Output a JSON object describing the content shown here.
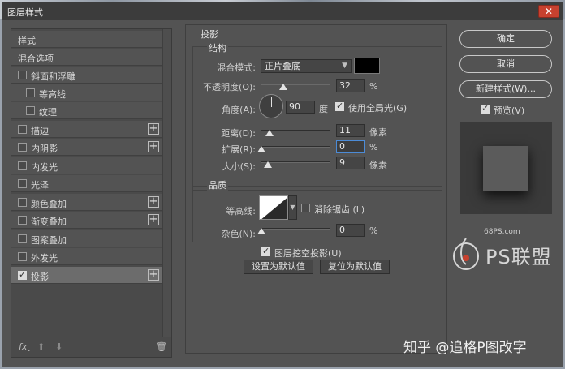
{
  "window": {
    "title": "图层样式",
    "close": "✕"
  },
  "left": {
    "items": [
      {
        "label": "样式"
      },
      {
        "label": "混合选项"
      },
      {
        "label": "斜面和浮雕"
      },
      {
        "label": "等高线"
      },
      {
        "label": "纹理"
      },
      {
        "label": "描边",
        "plus": "+"
      },
      {
        "label": "内阴影",
        "plus": "+"
      },
      {
        "label": "内发光"
      },
      {
        "label": "光泽"
      },
      {
        "label": "颜色叠加",
        "plus": "+"
      },
      {
        "label": "渐变叠加",
        "plus": "+"
      },
      {
        "label": "图案叠加"
      },
      {
        "label": "外发光"
      },
      {
        "label": "投影",
        "plus": "+"
      }
    ],
    "footer": {
      "fx": "fx",
      "fx_dot": ".",
      "up": "⬆",
      "down": "⬇",
      "trash": "🗑"
    }
  },
  "shadow": {
    "section_title": "投影",
    "structure": {
      "title": "结构",
      "blend_label": "混合模式:",
      "blend_value": "正片叠底",
      "opacity_label": "不透明度(O):",
      "opacity_value": "32",
      "opacity_unit": "%",
      "angle_label": "角度(A):",
      "angle_value": "90",
      "angle_unit": "度",
      "global_light_label": "使用全局光(G)",
      "distance_label": "距离(D):",
      "distance_value": "11",
      "distance_unit": "像素",
      "spread_label": "扩展(R):",
      "spread_value": "0",
      "spread_unit": "%",
      "size_label": "大小(S):",
      "size_value": "9",
      "size_unit": "像素"
    },
    "quality": {
      "title": "品质",
      "contour_label": "等高线:",
      "antialias_label": "消除锯齿 (L)",
      "noise_label": "杂色(N):",
      "noise_value": "0",
      "noise_unit": "%"
    },
    "knockout_label": "图层挖空投影(U)",
    "make_default": "设置为默认值",
    "reset_default": "复位为默认值"
  },
  "right": {
    "ok": "确定",
    "cancel": "取消",
    "new_style": "新建样式(W)...",
    "preview_label": "预览(V)"
  },
  "watermark": {
    "site": "68PS.com",
    "logo_text": "PS联盟",
    "bottom": "知乎 @追格P图改字"
  }
}
